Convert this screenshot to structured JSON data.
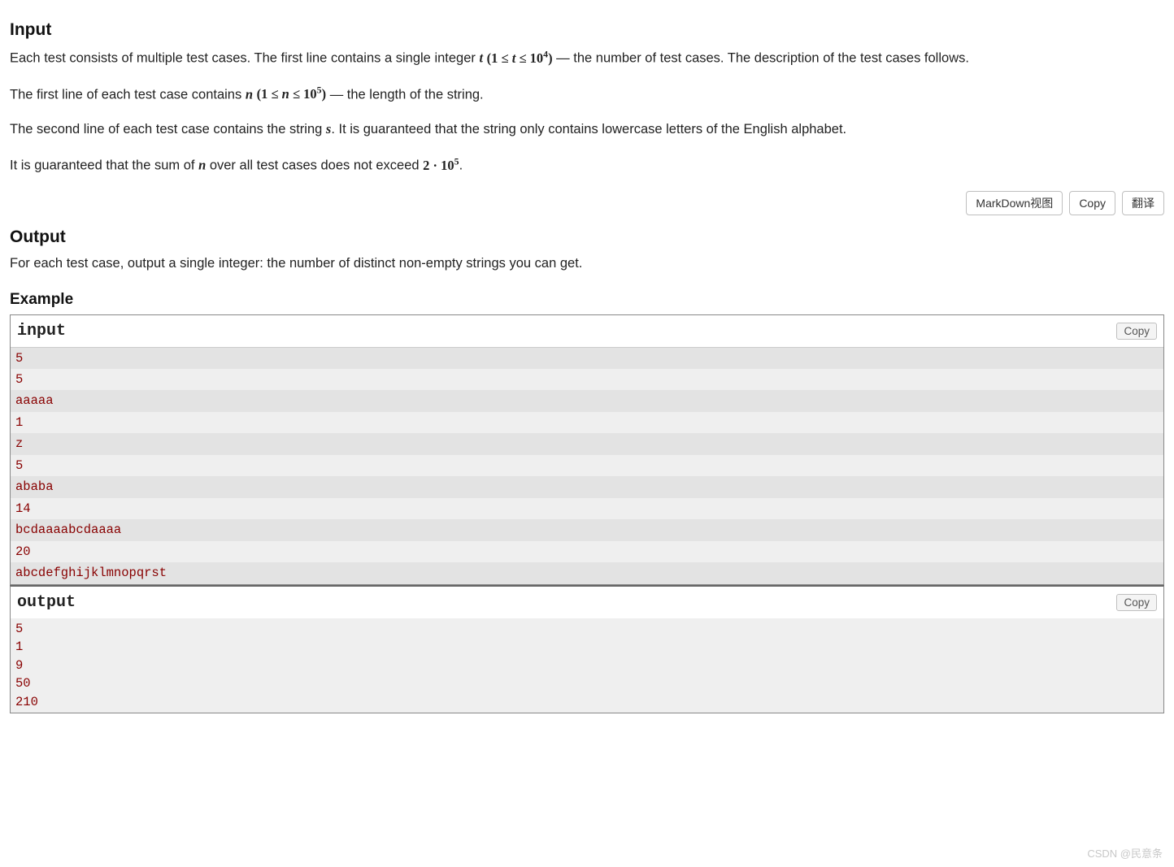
{
  "sections": {
    "input": {
      "heading": "Input",
      "p1_a": "Each test consists of multiple test cases. The first line contains a single integer ",
      "p1_b": " — the number of test cases. The description of the test cases follows.",
      "p2_a": "The first line of each test case contains ",
      "p2_b": " — the length of the string.",
      "p3_a": "The second line of each test case contains the string ",
      "p3_b": ". It is guaranteed that the string only contains lowercase letters of the English alphabet.",
      "p4_a": "It is guaranteed that the sum of ",
      "p4_b": " over all test cases does not exceed ",
      "p4_c": "."
    },
    "output": {
      "heading": "Output",
      "p1": "For each test case, output a single integer: the number of distinct non-empty strings you can get."
    },
    "example": {
      "heading": "Example"
    }
  },
  "math": {
    "t": "t",
    "t_range_open": "(1 ≤ ",
    "t_range_mid": " ≤ 10",
    "t_range_exp": "4",
    "t_range_close": ")",
    "n": "n",
    "n_range_open": "(1 ≤ ",
    "n_range_mid": " ≤ 10",
    "n_range_exp": "5",
    "n_range_close": ")",
    "s": "s",
    "two_dot_ten": "2 · 10",
    "two_dot_ten_exp": "5"
  },
  "buttons": {
    "markdown": "MarkDown视图",
    "copy": "Copy",
    "translate": "翻译"
  },
  "io": {
    "input_label": "input",
    "output_label": "output",
    "copy_label": "Copy",
    "input_lines": [
      "5",
      "5",
      "aaaaa",
      "1",
      "z",
      "5",
      "ababa",
      "14",
      "bcdaaaabcdaaaa",
      "20",
      "abcdefghijklmnopqrst"
    ],
    "output_lines": [
      "5",
      "1",
      "9",
      "50",
      "210"
    ]
  },
  "watermark": "CSDN @民意条"
}
